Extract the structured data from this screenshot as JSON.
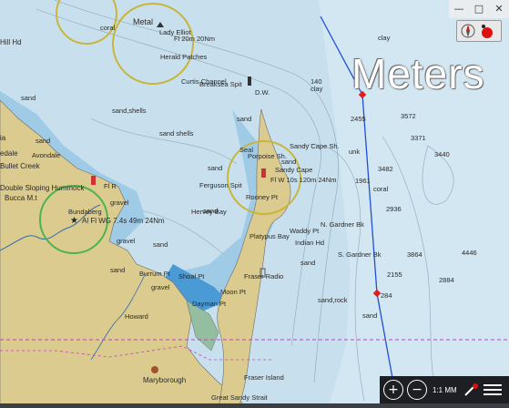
{
  "units_overlay": "Meters",
  "zoom_scale": "1:1 MM",
  "labels": {
    "metal": "Metal",
    "lady_elliot": "Lady Elliot",
    "fl_20m": "Fl 20m 20Nm",
    "herald_patches": "Herald Patches",
    "coral1": "coral",
    "hill_hd": "Hill Hd",
    "curtis_channel": "Curtis Channel",
    "breaksea_spit": "Breaksea Spit",
    "dw": "D.W.",
    "clay1": "clay",
    "clay2": "clay",
    "val_140": "140",
    "sand_shells1": "sand,shells",
    "sand_shells2": "sand shells",
    "sandy_cape_sh": "Sandy Cape Sh.",
    "seal": "Seal",
    "sand_a": "sand",
    "sand_b": "sand",
    "sand_c": "sand",
    "sand_d": "sand",
    "sand_e": "sand",
    "sand_f": "sand",
    "sand_g": "sand",
    "sand_h": "sand",
    "sand_i": "sand",
    "avondale": "Avondale",
    "bullet_creek": "Bullet Creek",
    "double_sloping": "Double Sloping Hummock",
    "bucca": "Bucca M.t",
    "ia": "ia",
    "edale": "edale",
    "bundaberg": "Bundaberg",
    "al_fl": "Al Fl WG 7.4s 49m 24Nm",
    "fl_r": "Fl R",
    "gravel1": "gravel",
    "gravel2": "gravel",
    "gravel3": "gravel",
    "ferguson_spit": "Ferguson Spit",
    "hervey_bay": "Hervey Bay",
    "porpoise": "Porpoise Sh.",
    "sandy_cape": "Sandy Cape",
    "fl_w": "Fl W 10s 120m 24Nm",
    "rooney_pt": "Rooney Pt",
    "unk": "unk",
    "coral2": "coral",
    "n_gardner": "N. Gardner Bk",
    "platypus": "Platypus Bay",
    "waddy": "Waddy Pt",
    "indian_hd": "Indian Hd",
    "s_gardner": "S. Gardner Bk",
    "burrum": "Burrum Pt",
    "shoal_pt": "Shoal Pt",
    "fraser_radio": "Fraser Radio",
    "moon_pt": "Moon Pt",
    "dayman_pt": "Dayman Pt",
    "sand_rock": "sand,rock",
    "howard": "Howard",
    "sand_j": "sand",
    "maryborough": "Maryborough",
    "fraser_island": "Fraser Island",
    "great_sandy": "Great Sandy Strait",
    "d2455": "2455",
    "d3572": "3572",
    "d3371": "3371",
    "d3440": "3440",
    "d1961": "1961",
    "d2936": "2936",
    "d2155": "2155",
    "d3482": "3482",
    "d284": "284",
    "d3864": "3864",
    "d4446": "4446",
    "d2884": "2884"
  },
  "icons": {
    "compass": "north-arrow-icon",
    "zoom_in": "zoom-in-icon",
    "zoom_out": "zoom-out-icon",
    "menu": "hamburger-menu-icon",
    "window": [
      "minimize-icon",
      "maximize-icon",
      "close-icon"
    ]
  },
  "colors": {
    "deep_water": "#c3dbe9",
    "shallow_water": "#5fa9d9",
    "land": "#d8c98c",
    "route": "#1f4fd6",
    "light_range": "#c9b53a",
    "buoy": "#e01e1e"
  }
}
